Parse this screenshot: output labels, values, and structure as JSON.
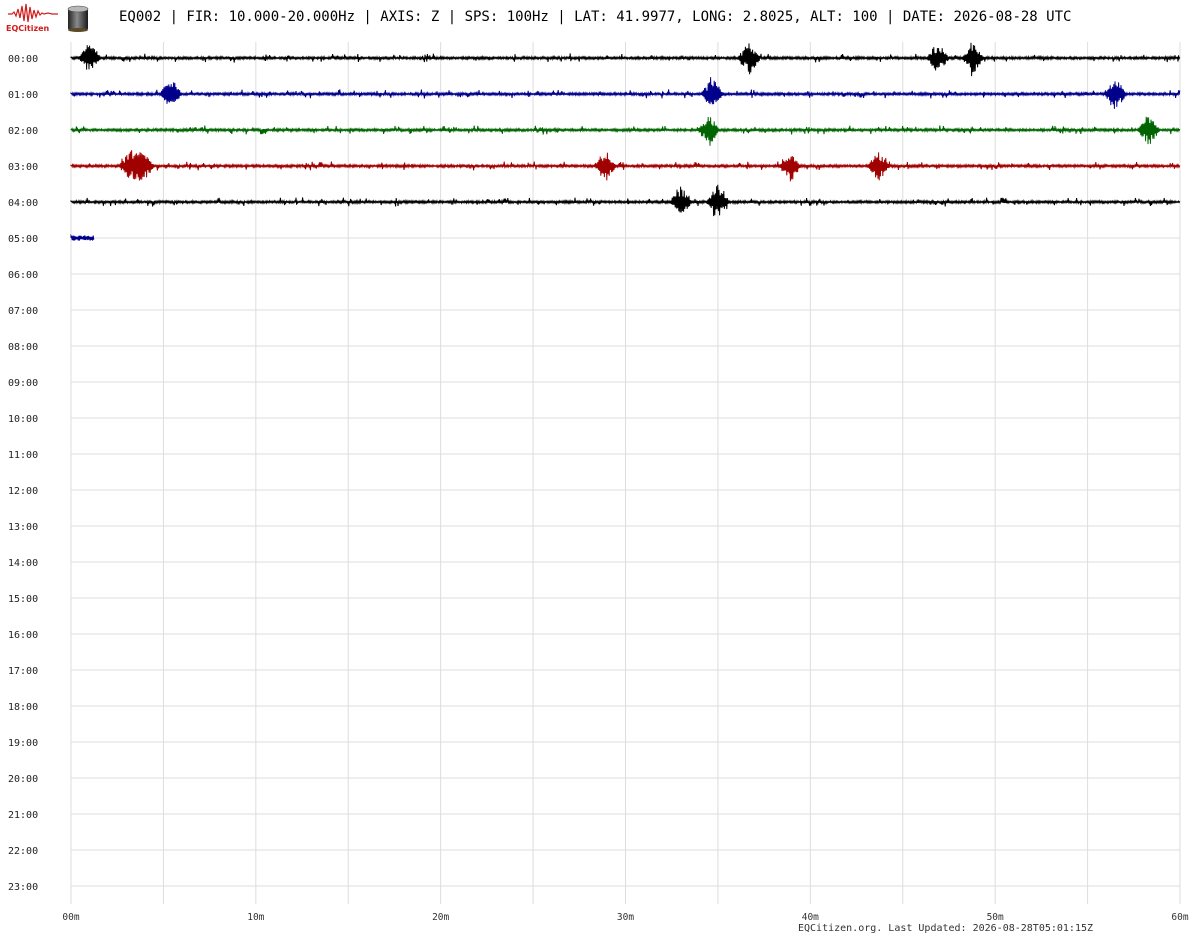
{
  "header": {
    "logo_text": "EQCitizen",
    "title": "EQ002 | FIR: 10.000-20.000Hz | AXIS: Z | SPS: 100Hz | LAT: 41.9977, LONG: 2.8025, ALT: 100 | DATE: 2026-08-28 UTC"
  },
  "footer": {
    "text": "EQCitizen.org. Last Updated: 2026-08-28T05:01:15Z"
  },
  "colors": {
    "trace_cycle": [
      "#000000",
      "#00008b",
      "#006400",
      "#a00000"
    ],
    "grid": "#dddddd",
    "logo": "#d01c1c"
  },
  "chart_data": {
    "type": "line",
    "kind": "helicorder",
    "hour_labels": [
      "00:00",
      "01:00",
      "02:00",
      "03:00",
      "04:00",
      "05:00",
      "06:00",
      "07:00",
      "08:00",
      "09:00",
      "10:00",
      "11:00",
      "12:00",
      "13:00",
      "14:00",
      "15:00",
      "16:00",
      "17:00",
      "18:00",
      "19:00",
      "20:00",
      "21:00",
      "22:00",
      "23:00"
    ],
    "minute_ticks": [
      "00m",
      "10m",
      "20m",
      "30m",
      "40m",
      "50m",
      "60m"
    ],
    "xlim": [
      0,
      60
    ],
    "grid": true,
    "series": [
      {
        "hour": "00:00",
        "minutes_recorded": 60,
        "color": "#000000",
        "events_min": [
          1.0,
          36.7,
          46.9,
          48.8
        ]
      },
      {
        "hour": "01:00",
        "minutes_recorded": 60,
        "color": "#00008b",
        "events_min": [
          5.4,
          34.7,
          56.5
        ]
      },
      {
        "hour": "02:00",
        "minutes_recorded": 60,
        "color": "#006400",
        "events_min": [
          34.5,
          58.3
        ]
      },
      {
        "hour": "03:00",
        "minutes_recorded": 60,
        "color": "#a00000",
        "events_min": [
          3.2,
          3.9,
          28.9,
          38.9,
          43.7
        ]
      },
      {
        "hour": "04:00",
        "minutes_recorded": 60,
        "color": "#000000",
        "events_min": [
          33.0,
          35.0
        ]
      },
      {
        "hour": "05:00",
        "minutes_recorded": 1.25,
        "color": "#00008b",
        "events_min": []
      }
    ]
  }
}
